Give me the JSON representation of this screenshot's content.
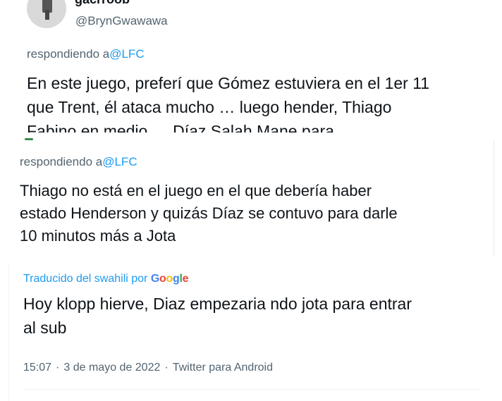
{
  "tweet_top": {
    "display_name": "gacrroob",
    "handle": "@BrynGwawawa",
    "replying_prefix": "respondiendo a",
    "replying_mention": "@LFC",
    "text_lines": [
      "En este juego, preferí que Gómez estuviera en el 1er 11",
      "que Trent, él ataca mucho … luego hender, Thiago",
      "Fabino en medio … Díaz Salah Mane para"
    ]
  },
  "tweet_middle": {
    "replying_prefix": "respondiendo a",
    "replying_mention": "@LFC",
    "text_lines": [
      "Thiago no está en el juego en el que debería haber",
      "estado Henderson y quizás Díaz se contuvo para darle",
      "10 minutos más a Jota"
    ]
  },
  "tweet_bottom": {
    "translated_label": "Traducido del swahili por",
    "translator_brand": "Google",
    "text_lines": [
      "Hoy klopp hierve, Diaz empezaria ndo jota para entrar",
      "al sub"
    ],
    "time": "15:07",
    "date": "3 de mayo de 2022",
    "source": "Twitter para Android",
    "separator": "·"
  },
  "colors": {
    "text_primary": "#0f1419",
    "text_secondary": "#536471",
    "link": "#1d9bf0"
  }
}
